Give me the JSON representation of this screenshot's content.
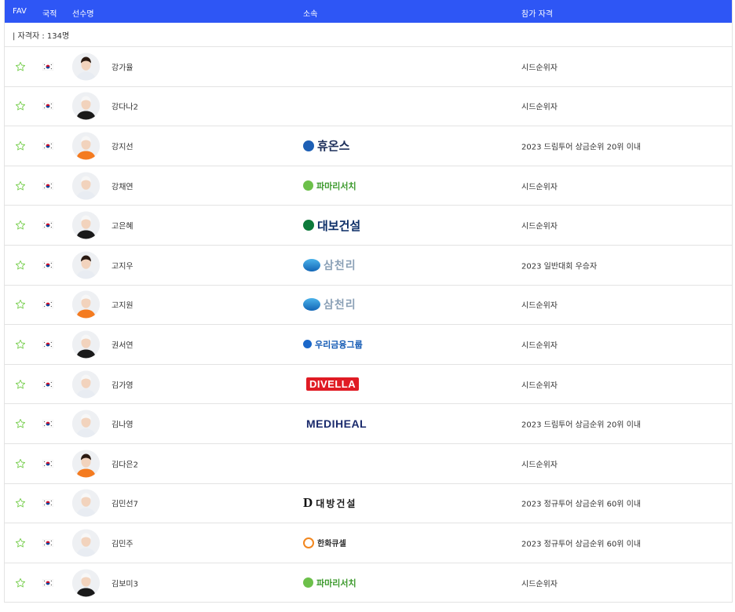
{
  "header": {
    "fav_label": "FAV",
    "nationality_label": "국적",
    "player_label": "선수명",
    "affiliation_label": "소속",
    "qualification_label": "참가 자격"
  },
  "summary": {
    "count_text": "| 자격자 : 134명"
  },
  "colors": {
    "header_bg": "#2e56f5",
    "star_green": "#79cf50"
  },
  "players": [
    {
      "name": "강가율",
      "logo": "",
      "logo_type": "none",
      "qualification": "시드순위자"
    },
    {
      "name": "강다나2",
      "logo": "",
      "logo_type": "none",
      "qualification": "시드순위자"
    },
    {
      "name": "강지선",
      "logo": "휴온스",
      "logo_type": "hu",
      "qualification": "2023 드림투어 상금순위 20위 이내"
    },
    {
      "name": "강채연",
      "logo": "파마리서치",
      "logo_type": "pm",
      "qualification": "시드순위자"
    },
    {
      "name": "고은혜",
      "logo": "대보건설",
      "logo_type": "db",
      "qualification": "시드순위자"
    },
    {
      "name": "고지우",
      "logo": "삼천리",
      "logo_type": "sc",
      "qualification": "2023 일반대회 우승자"
    },
    {
      "name": "고지원",
      "logo": "삼천리",
      "logo_type": "sc",
      "qualification": "시드순위자"
    },
    {
      "name": "권서연",
      "logo": "우리금융그룹",
      "logo_type": "wr",
      "qualification": "시드순위자"
    },
    {
      "name": "김가영",
      "logo": "DIVELLA",
      "logo_type": "dv",
      "qualification": "시드순위자"
    },
    {
      "name": "김나영",
      "logo": "MEDIHEAL",
      "logo_type": "mh",
      "qualification": "2023 드림투어 상금순위 20위 이내"
    },
    {
      "name": "김다은2",
      "logo": "",
      "logo_type": "none",
      "qualification": "시드순위자"
    },
    {
      "name": "김민선7",
      "logo": "대방건설",
      "logo_type": "dbc",
      "qualification": "2023 정규투어 상금순위 60위 이내"
    },
    {
      "name": "김민주",
      "logo": "한화큐셀",
      "logo_type": "hq",
      "qualification": "2023 정규투어 상금순위 60위 이내"
    },
    {
      "name": "김보미3",
      "logo": "파마리서치",
      "logo_type": "pm",
      "qualification": "시드순위자"
    }
  ]
}
